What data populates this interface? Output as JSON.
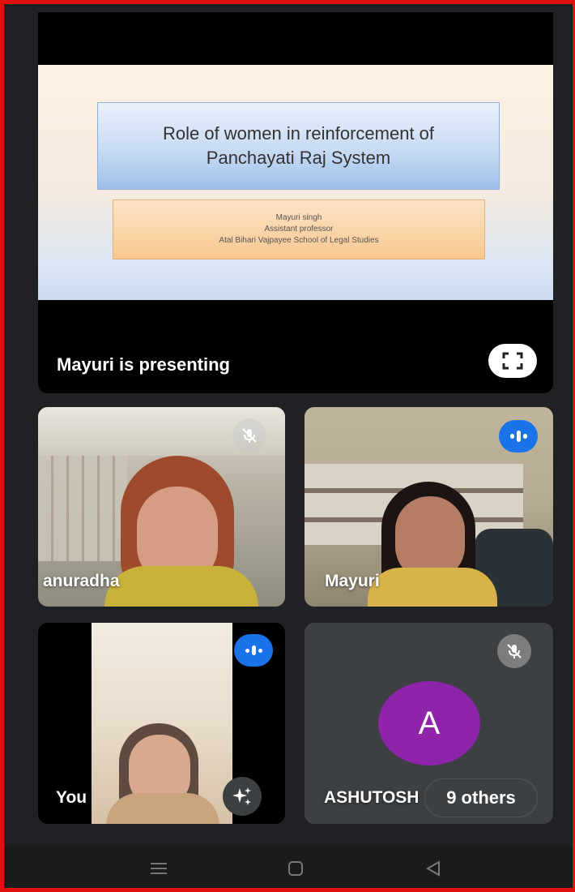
{
  "slide": {
    "title": "Role of women in reinforcement of Panchayati Raj System",
    "author_name": "Mayuri singh",
    "author_role": "Assistant professor",
    "author_org": "Atal Bihari Vajpayee School of Legal Studies"
  },
  "presentation": {
    "status_text": "Mayuri is presenting",
    "fullscreen_icon": "fullscreen-icon"
  },
  "participants": [
    {
      "name": "anuradha",
      "state": "muted",
      "icon": "mic-off-icon"
    },
    {
      "name": "Mayuri",
      "state": "speaking",
      "icon": "audio-level-icon"
    },
    {
      "name": "You",
      "state": "speaking",
      "icon": "audio-level-icon"
    },
    {
      "name": "ASHUTOSH",
      "state": "muted",
      "icon": "mic-off-icon",
      "avatar_letter": "A"
    }
  ],
  "others_chip": "9 others",
  "colors": {
    "speaking_badge": "#1a73e8",
    "avatar": "#8e24aa",
    "tile_bg": "#3c4043",
    "page_bg": "#202124"
  },
  "navbar": {
    "icons": [
      "menu-icon",
      "home-icon",
      "back-icon"
    ]
  }
}
